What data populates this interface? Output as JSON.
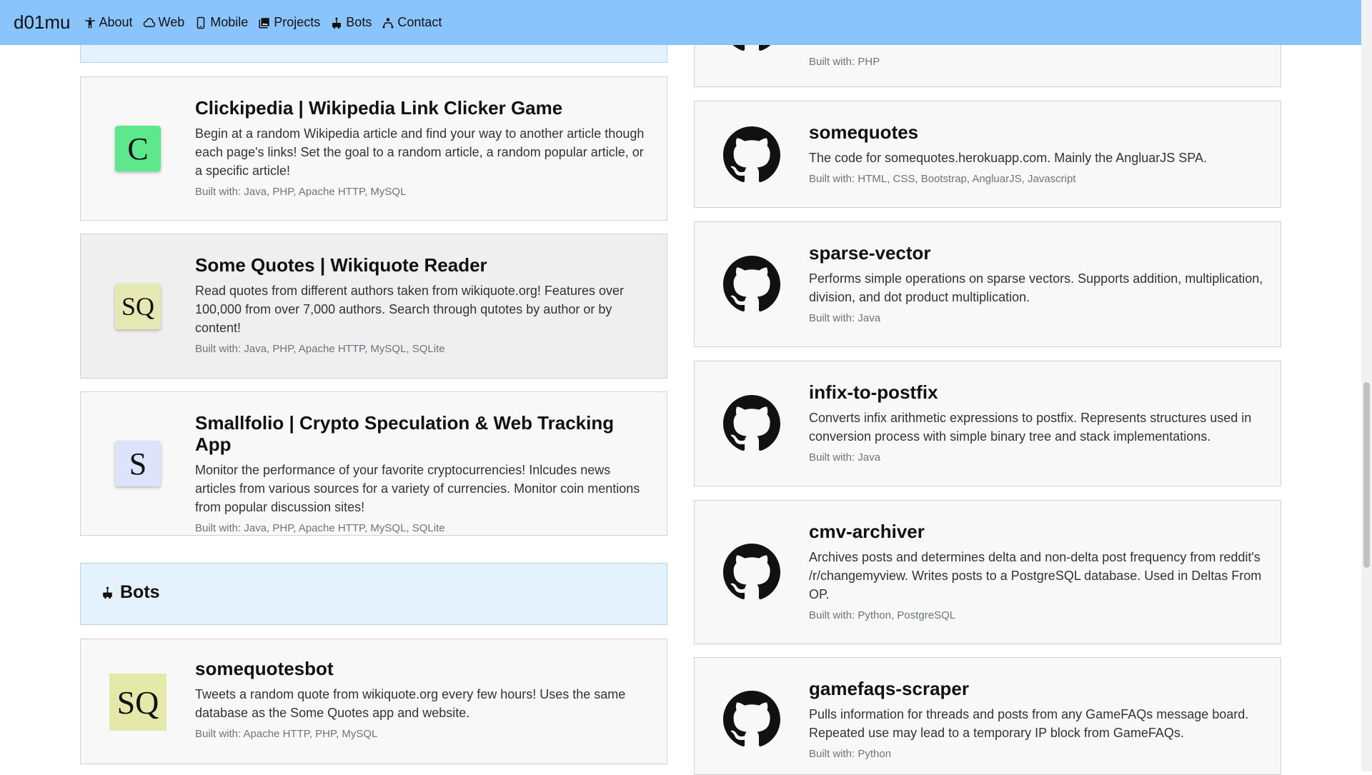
{
  "nav": {
    "brand": "d01mu",
    "items": [
      {
        "label": "About",
        "icon": "accessibility-icon"
      },
      {
        "label": "Web",
        "icon": "cloud-icon"
      },
      {
        "label": "Mobile",
        "icon": "mobile-icon"
      },
      {
        "label": "Projects",
        "icon": "image-icon"
      },
      {
        "label": "Bots",
        "icon": "robot-icon"
      },
      {
        "label": "Contact",
        "icon": "people-icon"
      }
    ]
  },
  "left": {
    "projects": [
      {
        "icon_letter": "C",
        "icon_color": "#5ee88e",
        "title": "Clickipedia | Wikipedia Link Clicker Game",
        "desc": "Begin at a random Wikipedia article and find your way to another article though each page's links! Set the goal to a random article, a random popular article, or a specific article!",
        "built": "Built with: Java, PHP, Apache HTTP, MySQL"
      },
      {
        "icon_letter": "SQ",
        "icon_color": "#e6e8b4",
        "title": "Some Quotes | Wikiquote Reader",
        "desc": "Read quotes from different authors taken from wikiquote.org! Features over 100,000 from over 7,000 authors. Search through qutotes by author or by content!",
        "built": "Built with: Java, PHP, Apache HTTP, MySQL, SQLite"
      },
      {
        "icon_letter": "S",
        "icon_color": "#dde3fb",
        "title": "Smallfolio | Crypto Speculation & Web Tracking App",
        "desc": "Monitor the performance of your favorite cryptocurrencies! Inlcudes news articles from various sources for a variety of currencies. Monitor coin mentions from popular discussion sites!",
        "built": "Built with: Java, PHP, Apache HTTP, MySQL, SQLite"
      }
    ],
    "bots_section": {
      "title": "Bots",
      "icon": "robot-icon"
    },
    "bots": [
      {
        "icon_letter": "SQ",
        "icon_color": "#e4e8a8",
        "title": "somequotesbot",
        "desc": "Tweets a random quote from wikiquote.org every few hours! Uses the same database as the Some Quotes app and website.",
        "built": "Built with: Apache HTTP, PHP, MySQL"
      }
    ]
  },
  "right": {
    "top_partial": {
      "built": "Built with: PHP",
      "icon": "github-icon"
    },
    "repos": [
      {
        "title": "somequotes",
        "desc": "The code for somequotes.herokuapp.com. Mainly the AngluarJS SPA.",
        "built": "Built with: HTML, CSS, Bootstrap, AngluarJS, Javascript",
        "icon": "github-icon"
      },
      {
        "title": "sparse-vector",
        "desc": "Performs simple operations on sparse vectors. Supports addition, multiplication, division, and dot product multiplication.",
        "built": "Built with: Java",
        "icon": "github-icon"
      },
      {
        "title": "infix-to-postfix",
        "desc": "Converts infix arithmetic expressions to postfix. Represents structures used in conversion process with simple binary tree and stack implementations.",
        "built": "Built with: Java",
        "icon": "github-icon"
      },
      {
        "title": "cmv-archiver",
        "desc": "Archives posts and determines delta and non-delta post frequency from reddit's /r/changemyview. Writes posts to a PostgreSQL database. Used in Deltas From OP.",
        "built": "Built with: Python, PostgreSQL",
        "icon": "github-icon"
      },
      {
        "title": "gamefaqs-scraper",
        "desc": "Pulls information for threads and posts from any GameFAQs message board. Repeated use may lead to a temporary IP block from GameFAQs.",
        "built": "Built with: Python",
        "icon": "github-icon"
      }
    ]
  }
}
